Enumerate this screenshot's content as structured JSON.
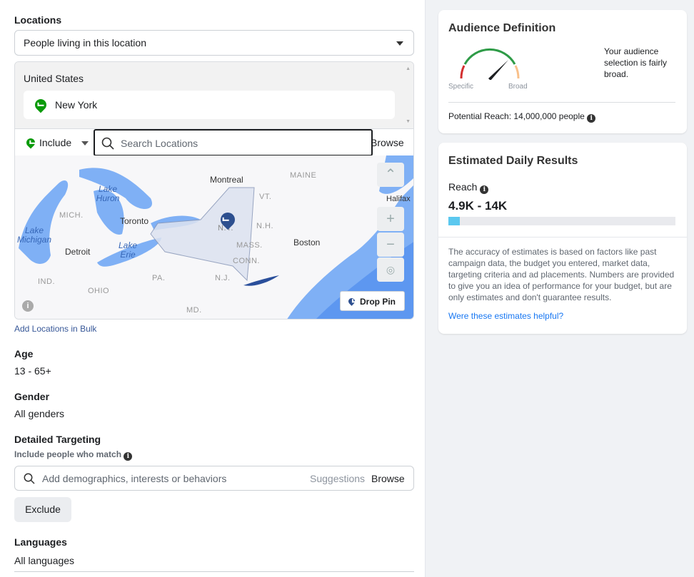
{
  "locations": {
    "label": "Locations",
    "mode": "People living in this location",
    "country": "United States",
    "selected": "New York",
    "include": "Include",
    "search_placeholder": "Search Locations",
    "browse": "Browse",
    "add_bulk": "Add Locations in Bulk",
    "map": {
      "labels": [
        "Montreal",
        "Toronto",
        "Detroit",
        "Boston",
        "Halifax"
      ],
      "states": [
        "MAINE",
        "VT.",
        "N.H.",
        "MASS.",
        "CONN.",
        "N.J.",
        "PA.",
        "OHIO",
        "IND.",
        "MICH.",
        "MD.",
        "N.Y."
      ],
      "lakes": [
        "Lake Huron",
        "Lake Michigan",
        "Lake Erie"
      ],
      "drop_pin": "Drop Pin",
      "zoom_in": "+",
      "zoom_out": "−"
    }
  },
  "age": {
    "label": "Age",
    "value": "13 - 65+"
  },
  "gender": {
    "label": "Gender",
    "value": "All genders"
  },
  "detailed": {
    "label": "Detailed Targeting",
    "sub": "Include people who match",
    "placeholder": "Add demographics, interests or behaviors",
    "suggestions": "Suggestions",
    "browse": "Browse",
    "exclude": "Exclude"
  },
  "languages": {
    "label": "Languages",
    "value": "All languages"
  },
  "audience": {
    "title": "Audience Definition",
    "specific": "Specific",
    "broad": "Broad",
    "message": "Your audience selection is fairly broad.",
    "reach": "Potential Reach: 14,000,000 people",
    "gauge_level": 0.72
  },
  "daily": {
    "title": "Estimated Daily Results",
    "reach_label": "Reach",
    "reach_value": "4.9K - 14K",
    "reach_fill_percent": 5,
    "disclaimer": "The accuracy of estimates is based on factors like past campaign data, the budget you entered, market data, targeting criteria and ad placements. Numbers are provided to give you an idea of performance for your budget, but are only estimates and don't guarantee results.",
    "feedback_link": "Were these estimates helpful?"
  },
  "colors": {
    "accent": "#1877f2",
    "pin": "#0a9a0a",
    "bar": "#5bc8ef",
    "map_water": "#7fb0f5",
    "gauge_green": "#2e9b47",
    "gauge_red": "#d32f2f",
    "gauge_orange": "#f9c08a"
  }
}
